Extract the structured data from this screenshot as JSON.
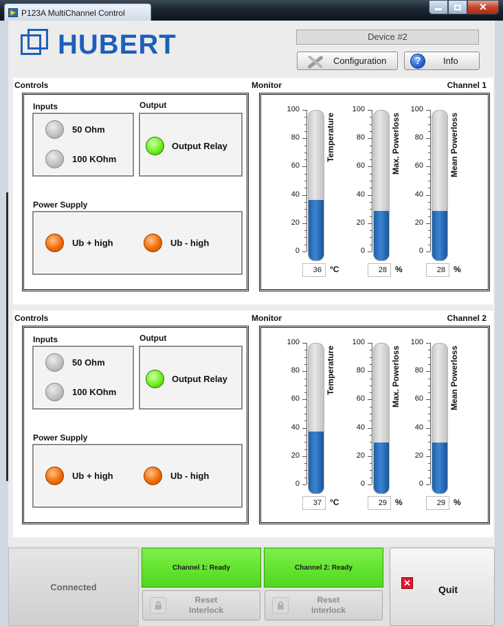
{
  "window": {
    "title": "P123A MultiChannel Control"
  },
  "header": {
    "logo_text": "HUBERT",
    "device": "Device #2",
    "config_label": "Configuration",
    "info_label": "Info"
  },
  "labels": {
    "controls": "Controls",
    "monitor": "Monitor",
    "inputs": "Inputs",
    "output": "Output",
    "power_supply": "Power Supply",
    "input_50": "50 Ohm",
    "input_100k": "100 KOhm",
    "output_relay": "Output Relay",
    "ub_plus": "Ub + high",
    "ub_minus": "Ub - high",
    "gauge_temp": "Temperature",
    "gauge_max": "Max. Powerloss",
    "gauge_mean": "Mean Powerloss",
    "unit_c": "°C",
    "unit_pct": "%",
    "scale": [
      "100",
      "80",
      "60",
      "40",
      "20",
      "0"
    ]
  },
  "channels": [
    {
      "name": "Channel 1",
      "inputs": {
        "ohm50": "off",
        "kohm100": "off"
      },
      "output_relay": "on",
      "power": {
        "ub_plus": "on",
        "ub_minus": "on"
      },
      "temperature": "36",
      "max_powerloss": "28",
      "mean_powerloss": "28"
    },
    {
      "name": "Channel 2",
      "inputs": {
        "ohm50": "off",
        "kohm100": "off"
      },
      "output_relay": "on",
      "power": {
        "ub_plus": "on",
        "ub_minus": "on"
      },
      "temperature": "37",
      "max_powerloss": "29",
      "mean_powerloss": "29"
    }
  ],
  "footer": {
    "connected": "Connected",
    "ch1_status": "Channel 1: Ready",
    "ch2_status": "Channel 2: Ready",
    "reset_line1": "Reset",
    "reset_line2": "Interlock",
    "quit": "Quit"
  },
  "colors": {
    "brand": "#1e5fb8",
    "led_green": "#6ef01c",
    "led_orange": "#f26a06",
    "led_gray": "#bdbdbd",
    "gauge_fill": "#2a70bb",
    "ready_green": "#5fe02a"
  }
}
